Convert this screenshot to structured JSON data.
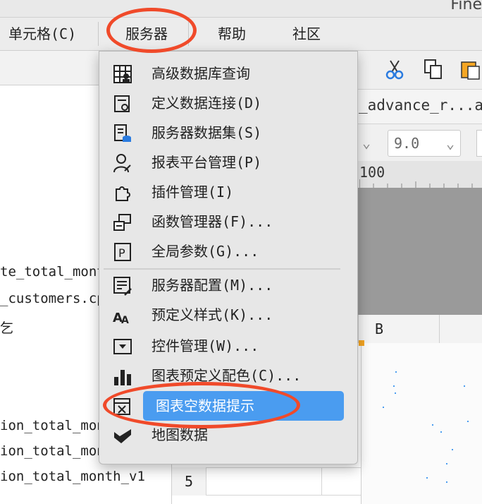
{
  "window": {
    "title_fragment": "Fine"
  },
  "menubar": {
    "cell_label": "单元格(C)",
    "server_label": "服务器",
    "help_label": "帮助",
    "community_label": "社区"
  },
  "left_panel": {
    "items": [
      "te_total_mont",
      "_customers.cp",
      "乞",
      "ion_total_mon",
      "ion_total_mon",
      "ion_total_month_v1"
    ]
  },
  "editor": {
    "tab_label": "_advance_r...at",
    "font_size_value": "9.0",
    "ruler_label": "100",
    "column_b": "B",
    "row_5": "5"
  },
  "server_menu": {
    "items": [
      {
        "label": "高级数据库查询",
        "icon": "advanced-db-query-icon"
      },
      {
        "label": "定义数据连接(D)",
        "icon": "data-connection-icon"
      },
      {
        "label": "服务器数据集(S)",
        "icon": "server-dataset-icon"
      },
      {
        "label": "报表平台管理(P)",
        "icon": "platform-management-icon"
      },
      {
        "label": "插件管理(I)",
        "icon": "plugin-icon"
      },
      {
        "label": "函数管理器(F)...",
        "icon": "function-manager-icon"
      },
      {
        "label": "全局参数(G)...",
        "icon": "global-parameter-icon"
      },
      {
        "label": "服务器配置(M)...",
        "icon": "server-config-icon"
      },
      {
        "label": "预定义样式(K)...",
        "icon": "predefined-style-icon"
      },
      {
        "label": "控件管理(W)...",
        "icon": "widget-management-icon"
      },
      {
        "label": "图表预定义配色(C)...",
        "icon": "chart-color-icon"
      },
      {
        "label": "图表空数据提示",
        "icon": "chart-empty-data-icon"
      },
      {
        "label": "地图数据",
        "icon": "map-data-icon"
      }
    ],
    "highlighted_index": 11
  },
  "colors": {
    "highlight": "#4a9cf0",
    "annotation": "#f04a2a"
  }
}
